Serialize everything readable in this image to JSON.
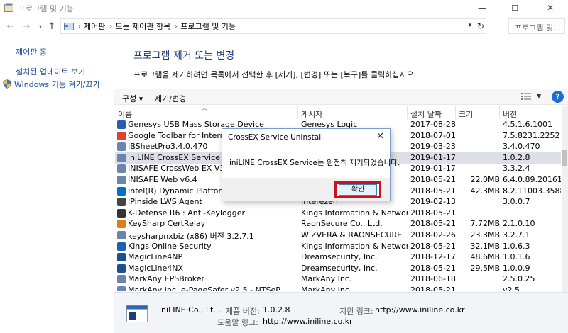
{
  "window": {
    "title": "프로그램 및 기능",
    "minimize_glyph": "—",
    "maximize_glyph": "☐",
    "close_glyph": "✕"
  },
  "address": {
    "crumbs": [
      "제어판",
      "모든 제어판 항목",
      "프로그램 및 기능"
    ],
    "search_placeholder": "프로그램 및..."
  },
  "sidebar": {
    "items": [
      {
        "label": "제어판 홈"
      },
      {
        "label": "설치된 업데이트 보기"
      },
      {
        "label": "Windows 기능 켜기/끄기"
      }
    ]
  },
  "main": {
    "heading": "프로그램 제거 또는 변경",
    "instructions": "프로그램을 제거하려면 목록에서 선택한 후 [제거], [변경] 또는 [복구]를 클릭하십시오."
  },
  "toolbar": {
    "organize_label": "구성 ▾",
    "uninstall_change_label": "제거/변경",
    "help_glyph": "?"
  },
  "columns": {
    "name": "이름",
    "publisher": "게시자",
    "installed_on": "설치 날짜",
    "size": "크기",
    "version": "버전"
  },
  "programs": [
    {
      "name": "Genesys USB Mass Storage Device",
      "publisher": "Genesys Logic",
      "date": "2017-08-28",
      "size": "",
      "version": "4.5.1.6.1001",
      "icon": "usb-icon",
      "color": "#2a5db0"
    },
    {
      "name": "Google Toolbar for Internet Explorer",
      "publisher": "",
      "date": "2018-07-01",
      "size": "",
      "version": "7.5.8231.2252",
      "icon": "google-icon",
      "color": "#e0412f"
    },
    {
      "name": "IBSheetPro3.4.0.470",
      "publisher": "",
      "date": "2019-03-23",
      "size": "",
      "version": "3.4.0.470",
      "icon": "program-icon",
      "color": "#6b86a8"
    },
    {
      "name": "iniLINE CrossEX Service",
      "publisher": "",
      "date": "2019-01-17",
      "size": "",
      "version": "1.0.2.8",
      "icon": "program-icon",
      "color": "#6b86a8",
      "selected": true
    },
    {
      "name": "INISAFE CrossWeb EX V3",
      "publisher": "",
      "date": "2019-01-17",
      "size": "",
      "version": "3.3.2.4",
      "icon": "program-icon",
      "color": "#6b86a8"
    },
    {
      "name": "INISAFE Web v6.4",
      "publisher": "",
      "date": "2018-05-21",
      "size": "22.0MB",
      "version": "6.4.0.89.20161210",
      "icon": "program-icon",
      "color": "#6b86a8"
    },
    {
      "name": "Intel(R) Dynamic Platform and Thermal",
      "publisher": "",
      "date": "2018-05-21",
      "size": "42.3MB",
      "version": "8.2.11003.3588",
      "icon": "intel-icon",
      "color": "#0071c5"
    },
    {
      "name": "IPinside LWS Agent",
      "publisher": "Interezen",
      "date": "2019-02-13",
      "size": "",
      "version": "3.0.0.7",
      "icon": "ipinside-icon",
      "color": "#444444"
    },
    {
      "name": "K-Defense R6 : Anti-Keylogger",
      "publisher": "Kings Information & Network C...",
      "date": "2018-05-21",
      "size": "",
      "version": "",
      "icon": "kdefense-icon",
      "color": "#333333"
    },
    {
      "name": "KeySharp CertRelay",
      "publisher": "RaonSecure Co., Ltd.",
      "date": "2018-05-21",
      "size": "7.72MB",
      "version": "2.1.0.10",
      "icon": "keysharp-icon",
      "color": "#e07a1a"
    },
    {
      "name": "keysharpnxbiz (x86) 버전 3.2.7.1",
      "publisher": "WIZVERA & RAONSECURE",
      "date": "2018-02-26",
      "size": "23.3MB",
      "version": "3.2.7.1",
      "icon": "program-icon",
      "color": "#6b86a8"
    },
    {
      "name": "Kings Online Security",
      "publisher": "Kings Information & Network C...",
      "date": "2018-05-21",
      "size": "32.1MB",
      "version": "1.0.6.3",
      "icon": "kings-icon",
      "color": "#1a5fb4"
    },
    {
      "name": "MagicLine4NP",
      "publisher": "Dreamsecurity, Inc.",
      "date": "2018-12-17",
      "size": "48.6MB",
      "version": "1.0.1.6",
      "icon": "magicline-icon",
      "color": "#1d4e8f"
    },
    {
      "name": "MagicLine4NX",
      "publisher": "Dreamsecurity, Inc.",
      "date": "2018-05-21",
      "size": "29.5MB",
      "version": "1.0.0.9",
      "icon": "magicline-icon",
      "color": "#1d4e8f"
    },
    {
      "name": "MarkAny EPSBroker",
      "publisher": "MarkAny Inc.",
      "date": "2018-06-18",
      "size": "",
      "version": "2.5.0.25",
      "icon": "program-icon",
      "color": "#6b86a8"
    },
    {
      "name": "MarkAny Inc. e-PageSafer v2.5 - NTSeP",
      "publisher": "MarkAny Inc.",
      "date": "2018-05-21",
      "size": "",
      "version": "v2.5",
      "icon": "program-icon",
      "color": "#6b86a8"
    }
  ],
  "details": {
    "publisher_name": "iniLINE Co., Lt...",
    "product_version_label": "제품 버전:",
    "product_version": "1.0.2.8",
    "support_link_label": "지원 링크:",
    "support_link": "http://www.iniline.co.kr",
    "help_link_label": "도움말 링크:",
    "help_link": "http://www.iniline.co.kr"
  },
  "dialog": {
    "title": "CrossEX Service UnInstall",
    "message": "iniLINE CrossEX Service는 완전히 제거되었습니다.",
    "ok_label": "확인",
    "close_glyph": "✕",
    "highlight_color": "#cc1020"
  }
}
